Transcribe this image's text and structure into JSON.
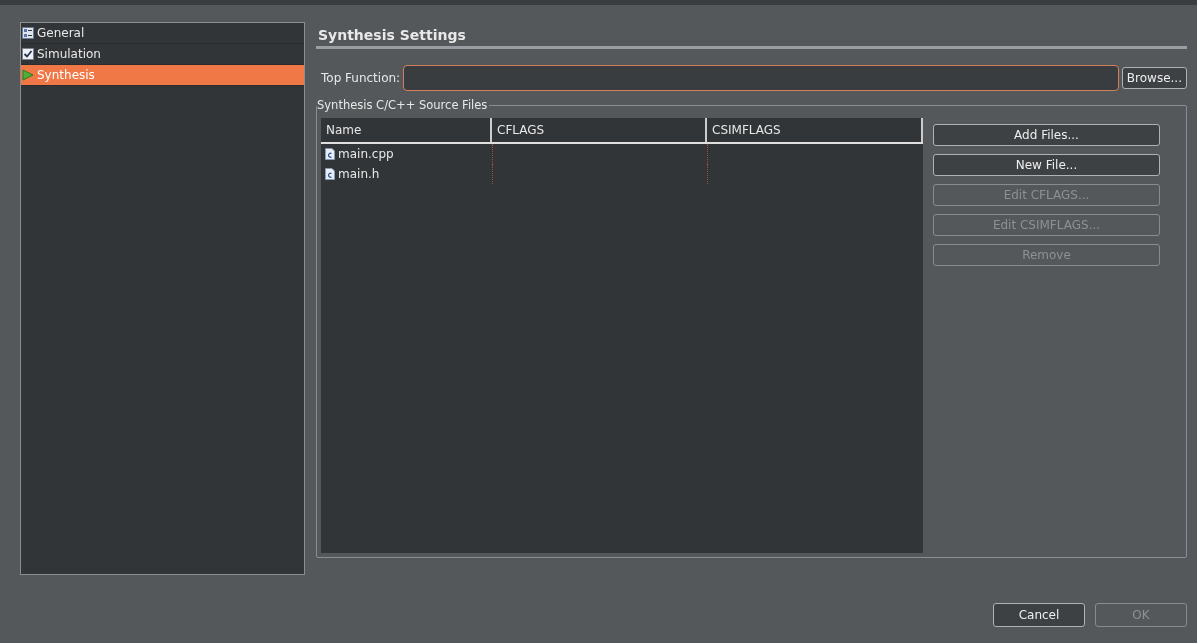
{
  "sidebar": {
    "items": [
      {
        "label": "General",
        "kind": "form",
        "selected": false
      },
      {
        "label": "Simulation",
        "kind": "check",
        "selected": false
      },
      {
        "label": "Synthesis",
        "kind": "play",
        "selected": true
      }
    ]
  },
  "panel": {
    "title": "Synthesis Settings",
    "top_function": {
      "label": "Top Function:",
      "button": "Browse..."
    },
    "source_files": {
      "legend": "Synthesis C/C++ Source Files",
      "columns": [
        "Name",
        "CFLAGS",
        "CSIMFLAGS"
      ],
      "rows": [
        {
          "name": "main.cpp"
        },
        {
          "name": "main.h"
        }
      ],
      "buttons": [
        {
          "label": "Add Files...",
          "disabled": false
        },
        {
          "label": "New File...",
          "disabled": false
        },
        {
          "label": "Edit CFLAGS...",
          "disabled": true
        },
        {
          "label": "Edit CSIMFLAGS...",
          "disabled": true
        },
        {
          "label": "Remove",
          "disabled": true
        }
      ]
    }
  },
  "footer": {
    "buttons": [
      {
        "label": "Cancel",
        "disabled": false
      },
      {
        "label": "OK",
        "disabled": true
      }
    ]
  }
}
